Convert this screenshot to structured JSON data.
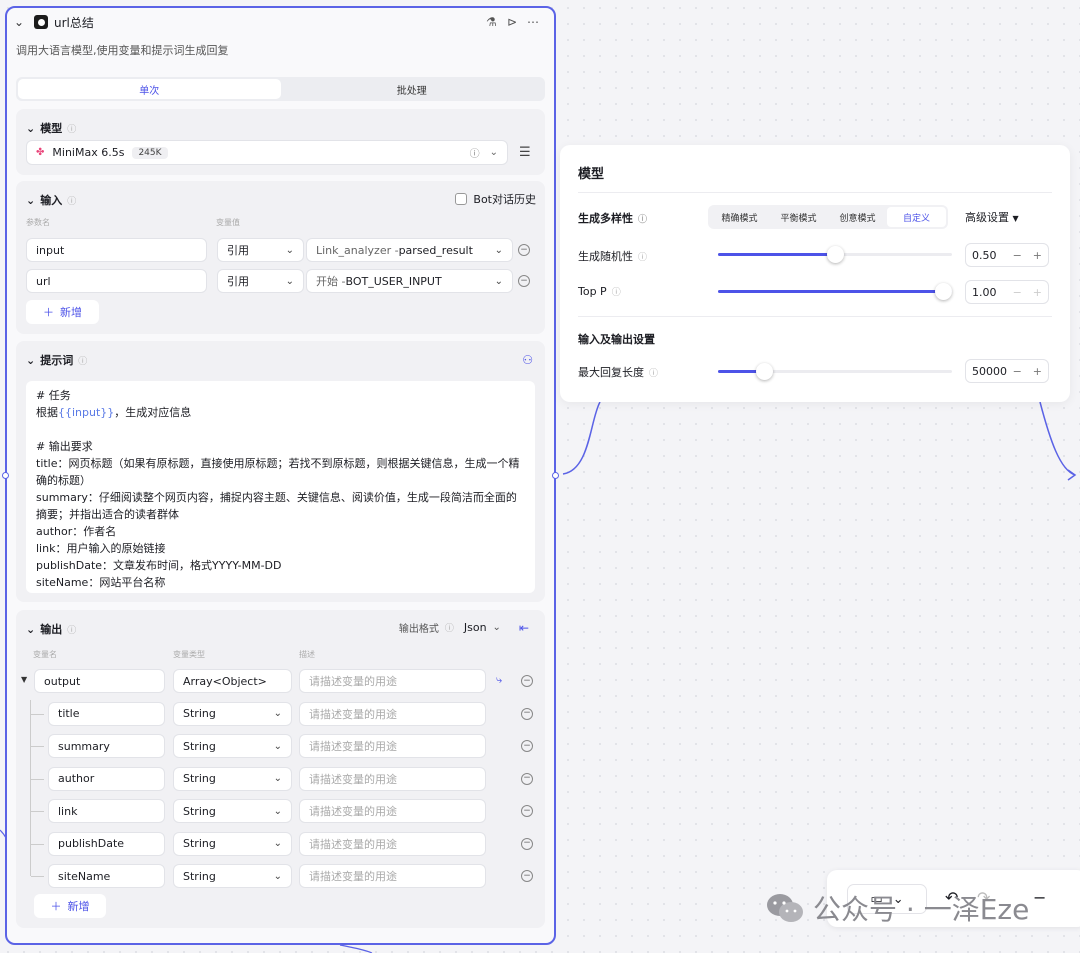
{
  "node": {
    "title": "url总结",
    "description": "调用大语言模型,使用变量和提示词生成回复",
    "tabs": [
      "单次",
      "批处理"
    ],
    "model_section": {
      "title": "模型",
      "model_name": "MiniMax 6.5s",
      "context_badge": "245K"
    },
    "input_section": {
      "title": "输入",
      "history_label": "Bot对话历史",
      "col_param": "参数名",
      "col_value": "变量值",
      "rows": [
        {
          "name": "input",
          "type": "引用",
          "ref_prefix": "Link_analyzer - ",
          "ref_value": "parsed_result"
        },
        {
          "name": "url",
          "type": "引用",
          "ref_prefix": "开始 - ",
          "ref_value": "BOT_USER_INPUT"
        }
      ],
      "add_label": "新增"
    },
    "prompt_section": {
      "title": "提示词",
      "lines": {
        "l1": "# 任务",
        "l2a": "根据",
        "l2var": "{{input}}",
        "l2b": "，生成对应信息",
        "l3": "# 输出要求",
        "l4": "title：网页标题（如果有原标题，直接使用原标题；若找不到原标题，则根据关键信息，生成一个精确的标题）",
        "l5": "summary：仔细阅读整个网页内容，捕捉内容主题、关键信息、阅读价值，生成一段简洁而全面的摘要；并指出适合的读者群体",
        "l6": "author：作者名",
        "l7": "link：用户输入的原始链接",
        "l8": "publishDate：文章发布时间，格式YYYY-MM-DD",
        "l9": "siteName：网站平台名称"
      }
    },
    "output_section": {
      "title": "输出",
      "format_label": "输出格式",
      "format_value": "Json",
      "col_name": "变量名",
      "col_type": "变量类型",
      "col_desc": "描述",
      "desc_placeholder": "请描述变量的用途",
      "root": {
        "name": "output",
        "type": "Array<Object>"
      },
      "children": [
        {
          "name": "title",
          "type": "String"
        },
        {
          "name": "summary",
          "type": "String"
        },
        {
          "name": "author",
          "type": "String"
        },
        {
          "name": "link",
          "type": "String"
        },
        {
          "name": "publishDate",
          "type": "String"
        },
        {
          "name": "siteName",
          "type": "String"
        }
      ],
      "add_label": "新增"
    }
  },
  "model_panel": {
    "title": "模型",
    "diversity_label": "生成多样性",
    "modes": [
      "精确模式",
      "平衡模式",
      "创意模式",
      "自定义"
    ],
    "active_mode": "自定义",
    "advanced_label": "高级设置",
    "temperature": {
      "label": "生成随机性",
      "value": "0.50",
      "fraction": 0.5
    },
    "top_p": {
      "label": "Top P",
      "value": "1.00",
      "fraction": 1.0
    },
    "io_title": "输入及输出设置",
    "max_len": {
      "label": "最大回复长度",
      "value": "50000",
      "fraction": 0.2
    }
  },
  "watermark": "公众号 · 一泽Eze",
  "colors": {
    "accent": "#4d53e8",
    "node_border": "#5b63e6"
  }
}
